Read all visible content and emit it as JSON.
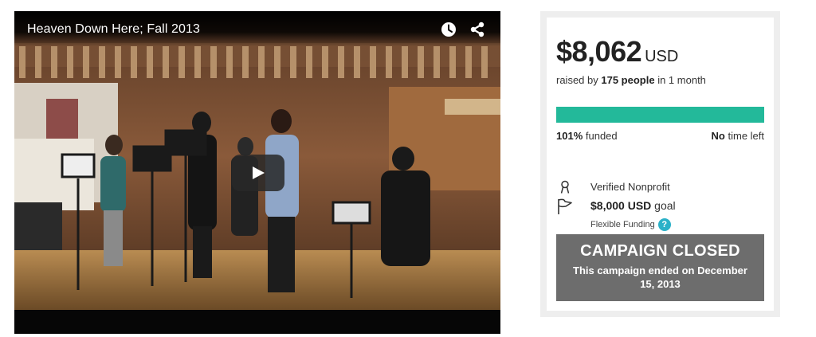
{
  "video": {
    "title": "Heaven Down Here; Fall 2013",
    "icons": {
      "watch_later": "clock-icon",
      "share": "share-icon",
      "play": "play-icon"
    }
  },
  "campaign": {
    "amount": "$8,062",
    "currency": "USD",
    "raised_prefix": "raised by",
    "people": "175 people",
    "duration": "in 1 month",
    "progress_fraction": 1.0,
    "funded_percent": "101%",
    "funded_suffix": "funded",
    "time_left_value": "No",
    "time_left_suffix": "time left",
    "verified_label": "Verified Nonprofit",
    "goal_amount": "$8,000",
    "goal_currency": "USD",
    "goal_suffix": "goal",
    "flexible_label": "Flexible Funding",
    "help_glyph": "?",
    "closed_title": "CAMPAIGN CLOSED",
    "closed_desc": "This campaign ended on December 15, 2013",
    "colors": {
      "progress": "#23b99a",
      "closed_bg": "#6d6d6d",
      "help": "#2bb1c8"
    }
  }
}
